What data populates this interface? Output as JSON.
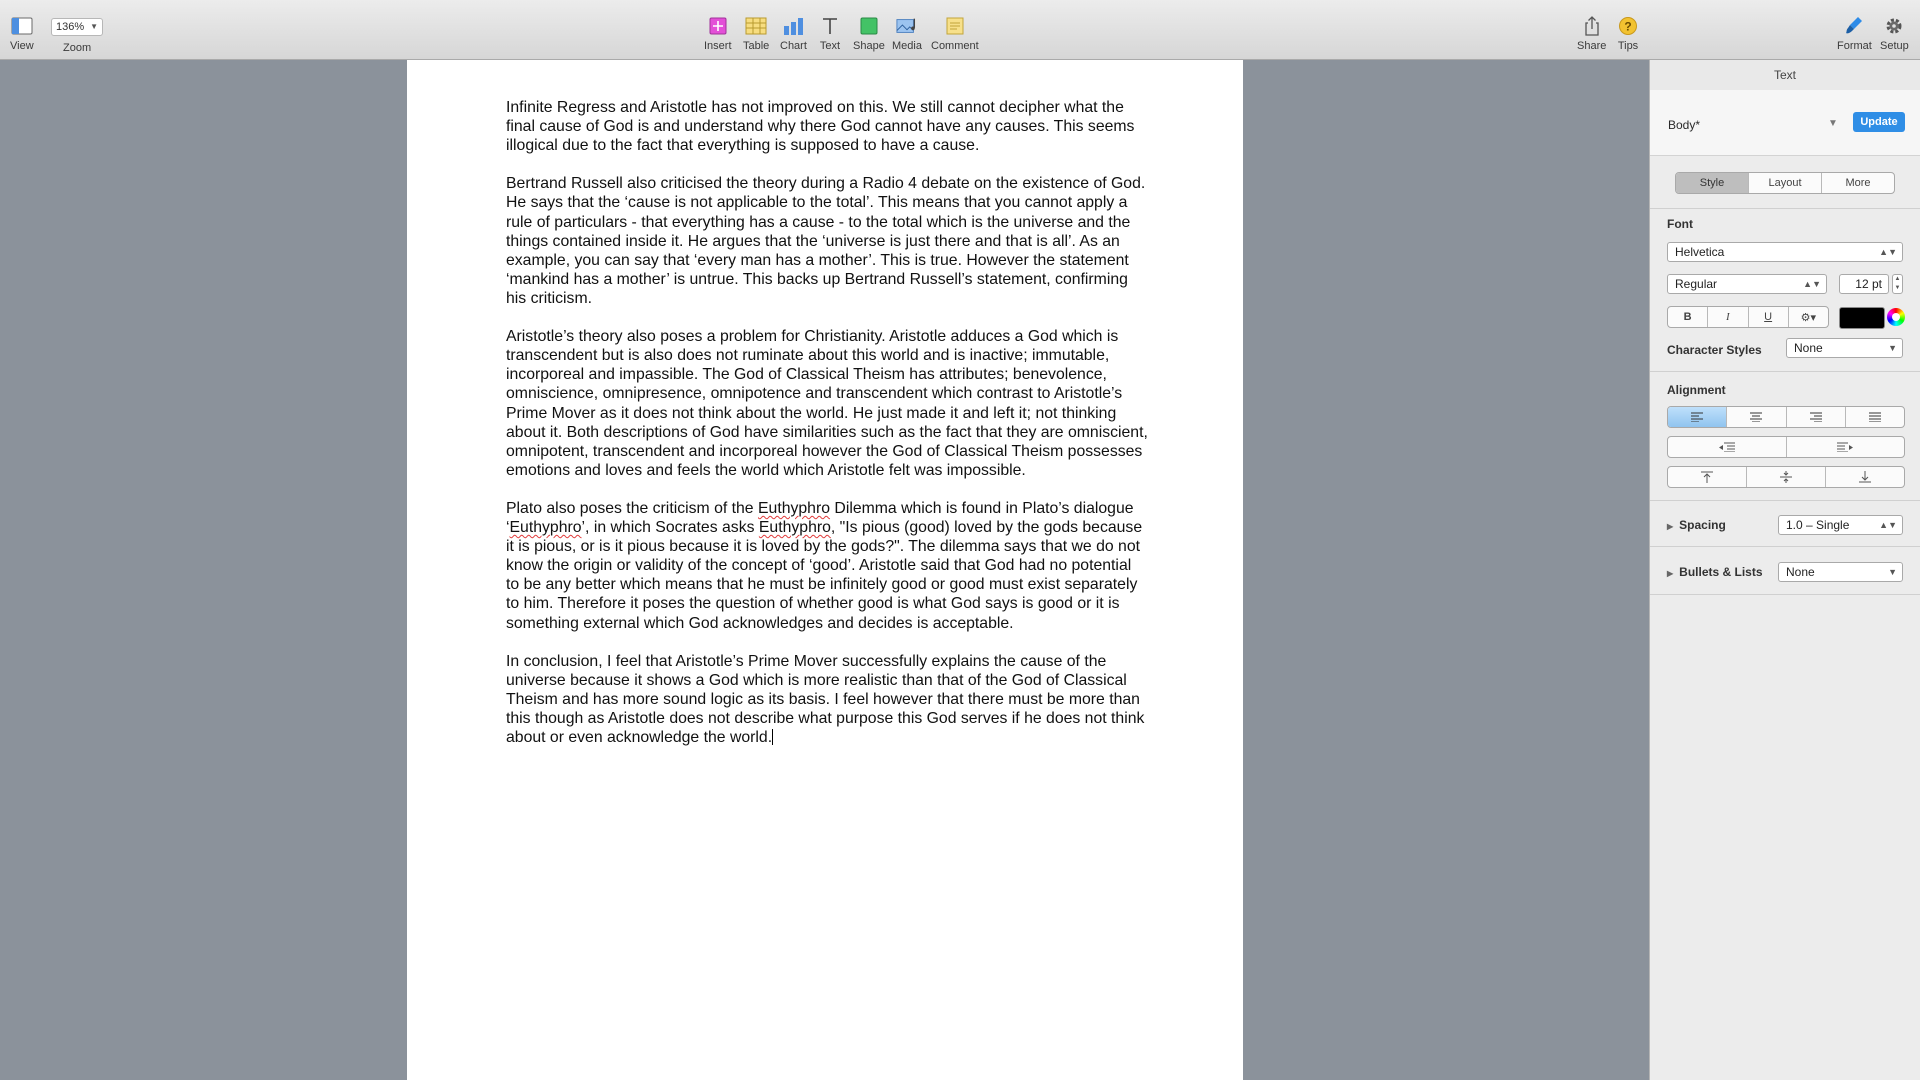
{
  "toolbar": {
    "view_label": "View",
    "zoom_value": "136%",
    "zoom_label": "Zoom",
    "insert_label": "Insert",
    "table_label": "Table",
    "chart_label": "Chart",
    "text_label": "Text",
    "shape_label": "Shape",
    "media_label": "Media",
    "comment_label": "Comment",
    "share_label": "Share",
    "tips_label": "Tips",
    "format_label": "Format",
    "setup_label": "Setup",
    "icon_colors": {
      "insert": "#e34fd7",
      "table": "#f2c94c",
      "chart": "#4f8fe0",
      "shape": "#43c266",
      "media": "#6aa3e8",
      "comment": "#f2d36b",
      "tips": "#f2c230",
      "format": "#2d8be8"
    }
  },
  "document": {
    "paragraphs": [
      {
        "parts": [
          {
            "text": "Infinite Regress and Aristotle has not improved on this. We still cannot decipher what the final cause of God is and understand why there God cannot have any causes. This seems illogical due to the fact that everything is supposed to have a cause."
          }
        ]
      },
      {
        "parts": [
          {
            "text": "Bertrand Russell also criticised the theory during a Radio 4 debate on the existence of God. He says that the ‘cause is not applicable to the total’. This means that you cannot apply a rule of particulars - that everything has a cause - to the total which is the universe and the things contained inside it. He argues that the ‘universe is just there and that is all’. As an example, you can say that ‘every man has a mother’. This is true. However the statement ‘mankind has a mother’ is untrue. This backs up Bertrand Russell’s statement, confirming his criticism."
          }
        ]
      },
      {
        "parts": [
          {
            "text": "Aristotle’s theory also poses a problem for Christianity. Aristotle adduces a God which is transcendent but is also does not ruminate about this world and is inactive; immutable, incorporeal and impassible. The God of Classical Theism has attributes; benevolence, omniscience, omnipresence, omnipotence and transcendent which contrast to Aristotle’s Prime Mover as it does not think about the world. He just made it and left it; not thinking about it. Both descriptions of God have similarities such as the fact that they are omniscient, omnipotent, transcendent and incorporeal however the God of Classical Theism possesses emotions and loves and feels the world which Aristotle felt was impossible."
          }
        ]
      },
      {
        "parts": [
          {
            "text": "Plato also poses the criticism of the "
          },
          {
            "text": "Euthyphro",
            "misspelled": true
          },
          {
            "text": " Dilemma which is found in Plato’s dialogue ‘"
          },
          {
            "text": "Euthyphro",
            "misspelled": true
          },
          {
            "text": "’, in which Socrates asks "
          },
          {
            "text": "Euthyphro",
            "misspelled": true
          },
          {
            "text": ", \"Is pious (good) loved by the gods because it is pious, or is it pious because it is loved by the gods?\". The dilemma says that we do not know the origin or validity of the concept of ‘good’. Aristotle said that God had no potential to be any better which means that he must be infinitely good or good must exist separately to him. Therefore it poses the question of whether good is what God says is good or it is something external which God acknowledges and decides is acceptable."
          }
        ]
      },
      {
        "parts": [
          {
            "text": "In conclusion, I feel that Aristotle’s Prime Mover successfully explains the cause of the universe because it shows a God which is more realistic than that of the God of Classical Theism and has more sound logic as its basis. I feel however that there must be more than this though as Aristotle does not describe what purpose this God serves if he does not think about or even acknowledge the world."
          }
        ],
        "cursor_at_end": true
      }
    ]
  },
  "inspector": {
    "title": "Text",
    "paragraph_style": "Body*",
    "update_label": "Update",
    "tabs": [
      {
        "label": "Style",
        "active": true
      },
      {
        "label": "Layout",
        "active": false
      },
      {
        "label": "More",
        "active": false
      }
    ],
    "font_section_label": "Font",
    "font_family": "Helvetica",
    "font_typeface": "Regular",
    "font_size": "12 pt",
    "bold_label": "B",
    "italic_label": "I",
    "underline_label": "U",
    "text_color": "#000000",
    "character_styles_label": "Character Styles",
    "character_styles_value": "None",
    "alignment_label": "Alignment",
    "alignment_active": "left",
    "spacing_label": "Spacing",
    "spacing_value": "1.0 – Single",
    "bullets_label": "Bullets & Lists",
    "bullets_value": "None"
  }
}
